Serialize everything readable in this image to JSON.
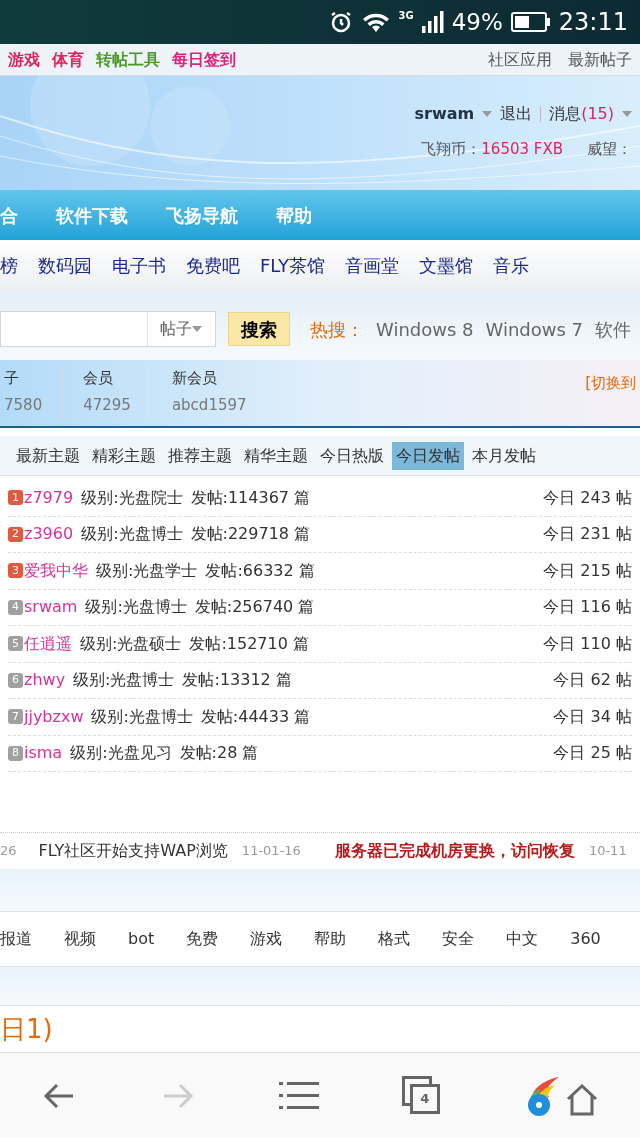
{
  "status_bar": {
    "network": "3G",
    "battery": "49%",
    "time": "23:11"
  },
  "top_links": {
    "left": [
      {
        "label": "游戏",
        "color": "#e0245e"
      },
      {
        "label": "体育",
        "color": "#e0245e"
      },
      {
        "label": "转帖工具",
        "color": "#4a9a2a"
      },
      {
        "label": "每日签到",
        "color": "#e0247e"
      }
    ],
    "right": [
      "社区应用",
      "最新帖子"
    ]
  },
  "user": {
    "name": "srwam",
    "logout": "退出",
    "messages_label": "消息",
    "messages_count": "(15)",
    "coins_label": "飞翔币：",
    "coins": "16503 FXB",
    "prestige_label": "威望："
  },
  "main_nav": [
    "合",
    "软件下载",
    "飞扬导航",
    "帮助"
  ],
  "sub_nav": [
    "榜",
    "数码园",
    "电子书",
    "免费吧",
    "FLY茶馆",
    "音画堂",
    "文墨馆",
    "音乐"
  ],
  "search": {
    "scope": "帖子",
    "button": "搜索",
    "hot_label": "热搜：",
    "hot": [
      "Windows 8",
      "Windows 7",
      "软件"
    ]
  },
  "stats": [
    {
      "label": "子",
      "value": "7580"
    },
    {
      "label": "会员",
      "value": "47295"
    },
    {
      "label": "新会员",
      "value": "abcd1597"
    }
  ],
  "switch_link": "[切换到",
  "tabs": [
    {
      "label": "最新主题",
      "selected": false
    },
    {
      "label": "精彩主题",
      "selected": false
    },
    {
      "label": "推荐主题",
      "selected": false
    },
    {
      "label": "精华主题",
      "selected": false
    },
    {
      "label": "今日热版",
      "selected": false
    },
    {
      "label": "今日发帖",
      "selected": true
    },
    {
      "label": "本月发帖",
      "selected": false
    }
  ],
  "ranking": [
    {
      "rank": "1",
      "top": true,
      "user": "z7979",
      "level": "级别:光盘院士",
      "posts": "发帖:114367 篇",
      "today": "今日 243 帖"
    },
    {
      "rank": "2",
      "top": true,
      "user": "z3960",
      "level": "级别:光盘博士",
      "posts": "发帖:229718 篇",
      "today": "今日 231 帖"
    },
    {
      "rank": "3",
      "top": true,
      "user": "爱我中华",
      "level": "级别:光盘学士",
      "posts": "发帖:66332 篇",
      "today": "今日 215 帖"
    },
    {
      "rank": "4",
      "top": false,
      "user": "srwam",
      "level": "级别:光盘博士",
      "posts": "发帖:256740 篇",
      "today": "今日 116 帖"
    },
    {
      "rank": "5",
      "top": false,
      "user": "任逍遥",
      "level": "级别:光盘硕士",
      "posts": "发帖:152710 篇",
      "today": "今日 110 帖"
    },
    {
      "rank": "6",
      "top": false,
      "user": "zhwy",
      "level": "级别:光盘博士",
      "posts": "发帖:13312 篇",
      "today": "今日 62 帖"
    },
    {
      "rank": "7",
      "top": false,
      "user": "jjybzxw",
      "level": "级别:光盘博士",
      "posts": "发帖:44433 篇",
      "today": "今日 34 帖"
    },
    {
      "rank": "8",
      "top": false,
      "user": "isma",
      "level": "级别:光盘见习",
      "posts": "发帖:28 篇",
      "today": "今日 25 帖"
    }
  ],
  "announcements": [
    {
      "kind": "date",
      "text": "26"
    },
    {
      "kind": "title",
      "text": "FLY社区开始支持WAP浏览"
    },
    {
      "kind": "date",
      "text": "11-01-16"
    },
    {
      "kind": "alert",
      "text": "服务器已完成机房更换，访问恢复"
    },
    {
      "kind": "date",
      "text": "10-11"
    }
  ],
  "tags": [
    "报道",
    "视频",
    "bot",
    "免费",
    "游戏",
    "帮助",
    "格式",
    "安全",
    "中文",
    "360"
  ],
  "section_heading": "日1)",
  "browser_bar": {
    "back_disabled": false,
    "forward_disabled": true,
    "tab_count": "4"
  }
}
